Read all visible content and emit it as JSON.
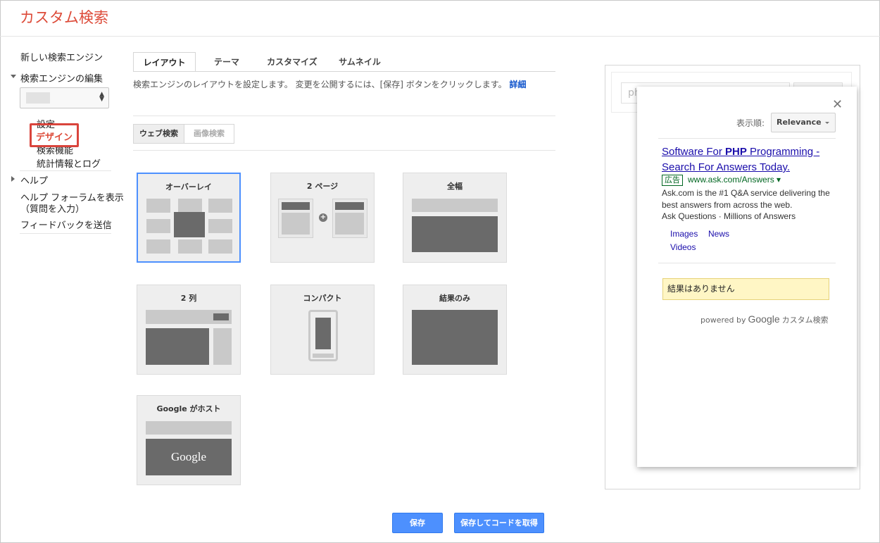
{
  "header": {
    "title": "カスタム検索"
  },
  "sidebar": {
    "new_engine": "新しい検索エンジン",
    "edit_engine": "検索エンジンの編集",
    "sub_items": {
      "settings": "設定",
      "design": "デザイン",
      "search_features": "検索機能",
      "stats": "統計情報とログ"
    },
    "help": "ヘルプ",
    "forum_line1": "ヘルプ フォーラムを表示",
    "forum_line2": "（質問を入力）",
    "feedback": "フィードバックを送信"
  },
  "tabs": [
    "レイアウト",
    "テーマ",
    "カスタマイズ",
    "サムネイル"
  ],
  "description": {
    "text": "検索エンジンのレイアウトを設定します。 変更を公開するには、[保存] ボタンをクリックします。",
    "link": "詳細"
  },
  "segments": [
    "ウェブ検索",
    "画像検索"
  ],
  "layouts": {
    "overlay": "オーバーレイ",
    "two_page": "2 ページ",
    "full_width": "全幅",
    "two_column": "2 列",
    "compact": "コンパクト",
    "results_only": "結果のみ",
    "google_hosted": "Google がホスト",
    "google_logo": "Google"
  },
  "buttons": {
    "save": "保存",
    "save_get_code": "保存してコードを取得"
  },
  "preview": {
    "query": "ph",
    "sort_label": "表示順:",
    "sort_value": "Relevance",
    "ad": {
      "title_a": "Software For ",
      "title_b": "PHP",
      "title_c": " Programming - Search For Answers Today.",
      "badge": "広告",
      "url": "www.ask.com/Answers ▾",
      "desc": "Ask.com is the #1 Q&A service delivering the best answers from across the web.",
      "tagline": "Ask Questions · Millions of Answers",
      "sitelinks": [
        "Images",
        "News",
        "Videos"
      ]
    },
    "no_results": "結果はありません",
    "powered_by": "powered by",
    "powered_google": "Google",
    "powered_cse": "カスタム検索"
  }
}
